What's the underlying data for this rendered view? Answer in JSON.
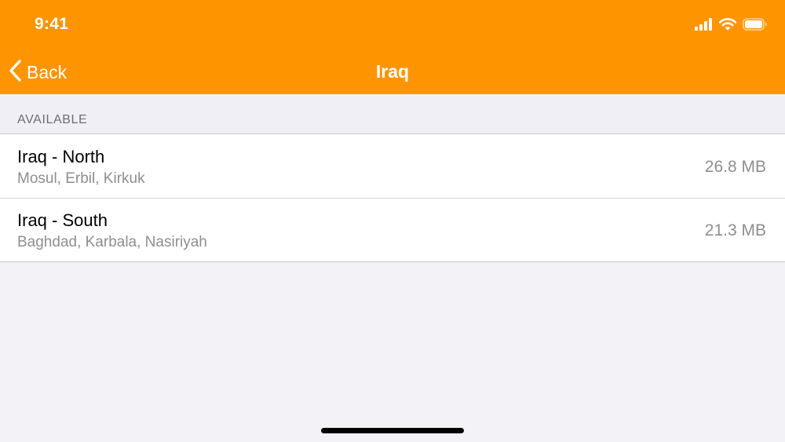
{
  "status_bar": {
    "time": "9:41",
    "icons": [
      "cellular-signal-icon",
      "wifi-icon",
      "battery-icon"
    ]
  },
  "nav": {
    "back_label": "Back",
    "title": "Iraq"
  },
  "section": {
    "title": "AVAILABLE"
  },
  "rows": [
    {
      "title": "Iraq - North",
      "subtitle": "Mosul, Erbil, Kirkuk",
      "size": "26.8 MB"
    },
    {
      "title": "Iraq - South",
      "subtitle": "Baghdad, Karbala, Nasiriyah",
      "size": "21.3 MB"
    }
  ],
  "colors": {
    "accent": "#fe9500",
    "background": "#f2f2f7",
    "secondary_text": "#8e8e93"
  }
}
